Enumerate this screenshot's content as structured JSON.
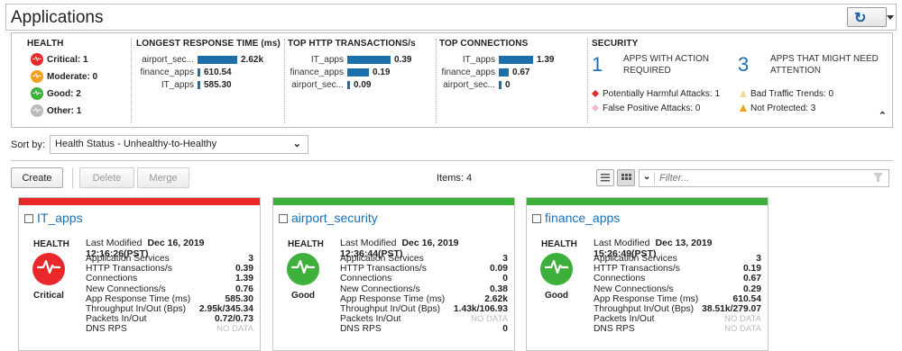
{
  "app": {
    "title": "Applications"
  },
  "colors": {
    "critical": "#e8282b",
    "moderate": "#f2a01c",
    "good": "#3db03b",
    "other": "#bbbbbb",
    "accent": "#1a6fb4",
    "bar": "#1a6fa8"
  },
  "summary": {
    "health": {
      "title": "HEALTH",
      "items": [
        {
          "label": "Critical: 1",
          "status": "critical"
        },
        {
          "label": "Moderate: 0",
          "status": "moderate"
        },
        {
          "label": "Good: 2",
          "status": "good"
        },
        {
          "label": "Other: 1",
          "status": "other"
        }
      ]
    },
    "response_time": {
      "title": "LONGEST RESPONSE TIME (ms)",
      "rows": [
        {
          "label": "airport_sec...",
          "value": "2.62k",
          "fill": 1.0
        },
        {
          "label": "finance_apps",
          "value": "610.54",
          "fill": 0.03
        },
        {
          "label": "IT_apps",
          "value": "585.30",
          "fill": 0.03
        }
      ]
    },
    "http_transactions": {
      "title": "TOP HTTP TRANSACTIONS/s",
      "rows": [
        {
          "label": "IT_apps",
          "value": "0.39",
          "fill": 1.0
        },
        {
          "label": "finance_apps",
          "value": "0.19",
          "fill": 0.49
        },
        {
          "label": "airport_sec...",
          "value": "0.09",
          "fill": 0.04
        }
      ]
    },
    "connections": {
      "title": "TOP CONNECTIONS",
      "rows": [
        {
          "label": "IT_apps",
          "value": "1.39",
          "fill": 1.0
        },
        {
          "label": "finance_apps",
          "value": "0.67",
          "fill": 0.29
        },
        {
          "label": "airport_sec...",
          "value": "0",
          "fill": 0.04
        }
      ]
    },
    "security": {
      "title": "SECURITY",
      "action_count": "1",
      "action_label_1": "APPS WITH ACTION",
      "action_label_2": "REQUIRED",
      "attention_count": "3",
      "attention_label_1": "APPS THAT MIGHT NEED",
      "attention_label_2": "ATTENTION",
      "harmful": "Potentially Harmful Attacks: 1",
      "bad_traffic": "Bad Traffic Trends: 0",
      "false_positive": "False Positive Attacks: 0",
      "not_protected": "Not Protected: 3"
    }
  },
  "sort": {
    "label": "Sort by:",
    "value": "Health Status - Unhealthy-to-Healthy"
  },
  "toolbar": {
    "create": "Create",
    "delete": "Delete",
    "merge": "Merge",
    "items": "Items: 4",
    "filter_placeholder": "Filter..."
  },
  "cards": [
    {
      "name": "IT_apps",
      "status": "critical",
      "health_label": "HEALTH",
      "status_label": "Critical",
      "last_modified_label": "Last Modified",
      "last_modified": "Dec 16, 2019 12:16:26(PST)",
      "metrics": [
        {
          "k": "Application Services",
          "v": "3"
        },
        {
          "k": "HTTP Transactions/s",
          "v": "0.39"
        },
        {
          "k": "Connections",
          "v": "1.39"
        },
        {
          "k": "New Connections/s",
          "v": "0.76"
        },
        {
          "k": "App Response Time (ms)",
          "v": "585.30"
        },
        {
          "k": "Throughput In/Out (Bps)",
          "v": "2.95k/345.34"
        },
        {
          "k": "Packets In/Out",
          "v": "0.72/0.73"
        },
        {
          "k": "DNS RPS",
          "v": "NO DATA"
        }
      ]
    },
    {
      "name": "airport_security",
      "status": "good",
      "health_label": "HEALTH",
      "status_label": "Good",
      "last_modified_label": "Last Modified",
      "last_modified": "Dec 16, 2019 12:36:44(PST)",
      "metrics": [
        {
          "k": "Application Services",
          "v": "3"
        },
        {
          "k": "HTTP Transactions/s",
          "v": "0.09"
        },
        {
          "k": "Connections",
          "v": "0"
        },
        {
          "k": "New Connections/s",
          "v": "0.38"
        },
        {
          "k": "App Response Time (ms)",
          "v": "2.62k"
        },
        {
          "k": "Throughput In/Out (Bps)",
          "v": "1.43k/106.93"
        },
        {
          "k": "Packets In/Out",
          "v": "NO DATA"
        },
        {
          "k": "DNS RPS",
          "v": "0"
        }
      ]
    },
    {
      "name": "finance_apps",
      "status": "good",
      "health_label": "HEALTH",
      "status_label": "Good",
      "last_modified_label": "Last Modified",
      "last_modified": "Dec 13, 2019 15:26:49(PST)",
      "metrics": [
        {
          "k": "Application Services",
          "v": "3"
        },
        {
          "k": "HTTP Transactions/s",
          "v": "0.19"
        },
        {
          "k": "Connections",
          "v": "0.67"
        },
        {
          "k": "New Connections/s",
          "v": "0.29"
        },
        {
          "k": "App Response Time (ms)",
          "v": "610.54"
        },
        {
          "k": "Throughput In/Out (Bps)",
          "v": "38.51k/279.07"
        },
        {
          "k": "Packets In/Out",
          "v": "NO DATA"
        },
        {
          "k": "DNS RPS",
          "v": "NO DATA"
        }
      ]
    }
  ]
}
